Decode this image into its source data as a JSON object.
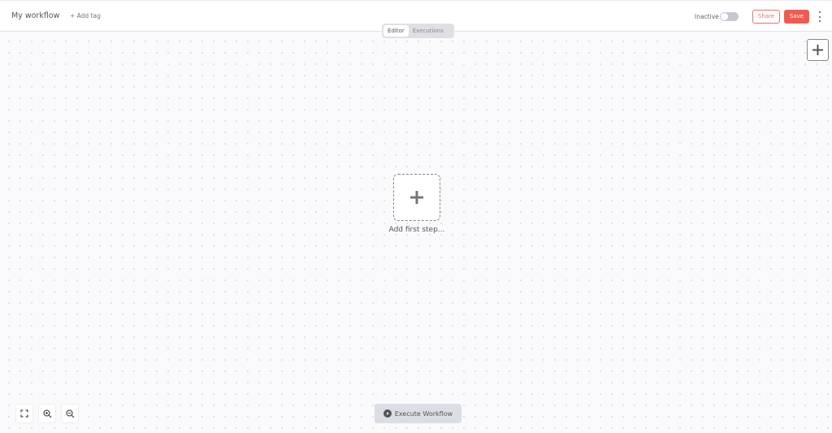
{
  "header": {
    "workflow_name": "My workflow",
    "add_tag_label": "+ Add tag",
    "active_status_label": "Inactive",
    "active": false,
    "share_label": "Share",
    "save_label": "Save"
  },
  "tabs": [
    {
      "label": "Editor",
      "active": true
    },
    {
      "label": "Executions",
      "active": false
    }
  ],
  "canvas": {
    "add_first_step_label": "Add first step...",
    "execute_label": "Execute Workflow"
  },
  "colors": {
    "accent": "#f25a50",
    "toggle_off": "#c6c8d0"
  },
  "icons": {
    "menu": "more-vertical-icon",
    "add_node": "plus-icon",
    "fit": "fit-view-icon",
    "zoom_in": "zoom-in-icon",
    "zoom_out": "zoom-out-icon",
    "play": "play-icon"
  }
}
